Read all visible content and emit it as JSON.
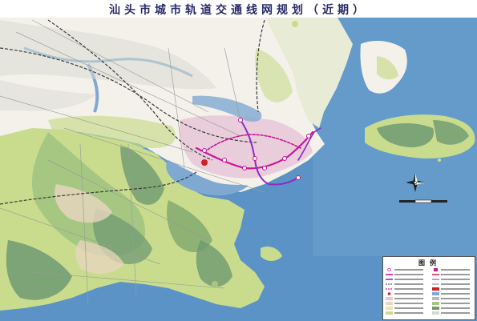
{
  "map": {
    "title": "汕头市城市轨道交通线网规划（近期）",
    "legend_title": "图例",
    "colors": {
      "sea": "#5b93c6",
      "land_light": "#f3f1ea",
      "green_light": "#c9dc8d",
      "green_mid": "#a6c782",
      "green_dark": "#6f9a72",
      "urban_pink": "#e8c7d8",
      "river": "#7fa9d1",
      "metro_line_1": "#c8189a",
      "metro_line_2": "#8a2cc4",
      "railway": "#3a3a3a",
      "road": "#9a9a9a"
    },
    "icons": [
      "compass-rose-icon",
      "scale-bar-icon",
      "station-icon"
    ]
  }
}
